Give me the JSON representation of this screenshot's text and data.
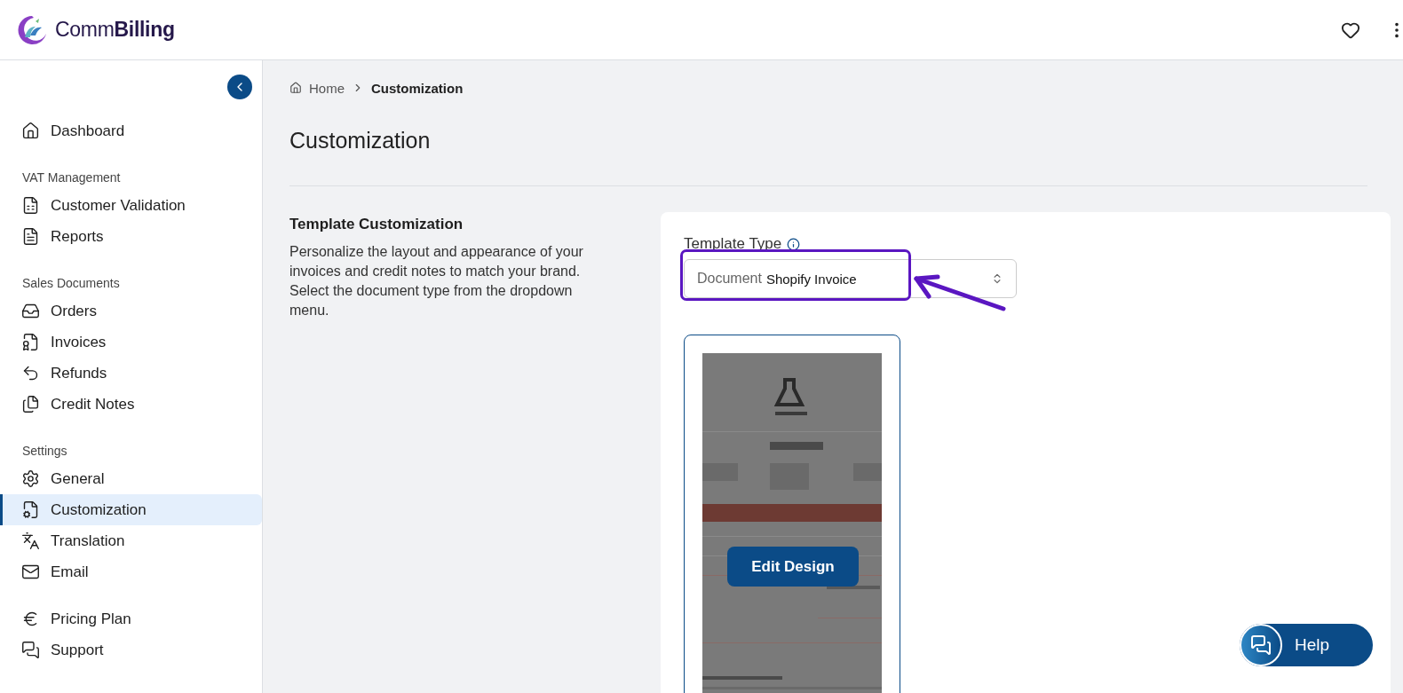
{
  "brand": {
    "light": "Comm",
    "bold": "Billing"
  },
  "sidebar": {
    "groups": [
      {
        "items": [
          {
            "label": "Dashboard",
            "selected": false
          }
        ]
      },
      {
        "heading": "VAT Management",
        "items": [
          {
            "label": "Customer Validation",
            "selected": false
          },
          {
            "label": "Reports",
            "selected": false
          }
        ]
      },
      {
        "heading": "Sales Documents",
        "items": [
          {
            "label": "Orders",
            "selected": false
          },
          {
            "label": "Invoices",
            "selected": false
          },
          {
            "label": "Refunds",
            "selected": false
          },
          {
            "label": "Credit Notes",
            "selected": false
          }
        ]
      },
      {
        "heading": "Settings",
        "items": [
          {
            "label": "General",
            "selected": false
          },
          {
            "label": "Customization",
            "selected": true
          },
          {
            "label": "Translation",
            "selected": false
          },
          {
            "label": "Email",
            "selected": false
          }
        ]
      },
      {
        "items": [
          {
            "label": "Pricing Plan",
            "selected": false
          },
          {
            "label": "Support",
            "selected": false
          }
        ]
      }
    ]
  },
  "breadcrumb": [
    {
      "label": "Home"
    },
    {
      "label": "Customization"
    }
  ],
  "page_title": "Customization",
  "section": {
    "title": "Template Customization",
    "description": "Personalize the layout and appearance of your invoices and credit notes to match your brand. Select the document type from the dropdown menu."
  },
  "template_type": {
    "label": "Template Type",
    "prefix": "Document",
    "value": "Shopify Invoice"
  },
  "preview": {
    "button": "Edit Design"
  },
  "help_button": "Help"
}
